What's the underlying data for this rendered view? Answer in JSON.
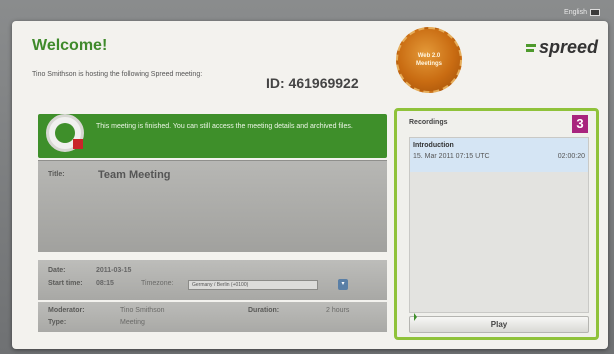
{
  "header": {
    "language": "English",
    "welcome": "Welcome!",
    "host_text": "Tino Smithson is hosting the following Spreed meeting:",
    "meeting_id": "ID: 461969922",
    "badge_line1": "Web 2.0",
    "badge_line2": "Meetings",
    "logo_text": "spreed"
  },
  "status": {
    "message": "This meeting is finished. You can still access the meeting details and archived files."
  },
  "details": {
    "title_label": "Title:",
    "title_value": "Team Meeting",
    "date_label": "Date:",
    "date_value": "2011-03-15",
    "start_label": "Start time:",
    "start_value": "08:15",
    "timezone_label": "Timezone:",
    "timezone_value": "Germany / Berlin (+0100)",
    "moderator_label": "Moderator:",
    "moderator_value": "Tino Smithson",
    "duration_label": "Duration:",
    "duration_value": "2 hours",
    "type_label": "Type:",
    "type_value": "Meeting"
  },
  "recordings": {
    "header": "Recordings",
    "badge": "3",
    "items": [
      {
        "title": "Introduction",
        "date": "15. Mar 2011 07:15 UTC",
        "length": "02:00:20"
      }
    ],
    "play_label": "Play"
  },
  "colors": {
    "accent_green": "#3e8f2a",
    "panel_border": "#8fc23a",
    "badge_orange": "#c96c12",
    "number_badge": "#a8247e"
  }
}
